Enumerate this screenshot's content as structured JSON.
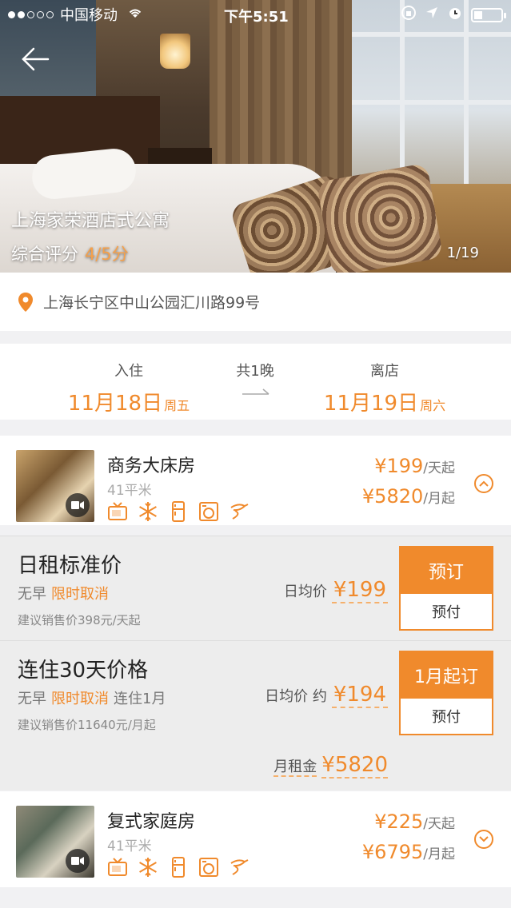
{
  "status_bar": {
    "carrier": "中国移动",
    "time": "下午5:51"
  },
  "hotel": {
    "name": "上海家荣酒店式公寓",
    "score_label": "综合评分",
    "score_value": "4/5分",
    "photo_counter": "1/19",
    "address": "上海长宁区中山公园汇川路99号"
  },
  "stay": {
    "checkin_label": "入住",
    "checkin_date": "11月18日",
    "checkin_weekday": "周五",
    "nights": "共1晚",
    "checkout_label": "离店",
    "checkout_date": "11月19日",
    "checkout_weekday": "周六"
  },
  "rooms": [
    {
      "name": "商务大床房",
      "area": "41平米",
      "daily_price": "¥199",
      "daily_suffix": "/天起",
      "monthly_price": "¥5820",
      "monthly_suffix": "/月起",
      "amenities": [
        "tv-icon",
        "ac-icon",
        "fridge-icon",
        "washer-icon",
        "hairdryer-icon"
      ],
      "expanded": true
    },
    {
      "name": "复式家庭房",
      "area": "41平米",
      "daily_price": "¥225",
      "daily_suffix": "/天起",
      "monthly_price": "¥6795",
      "monthly_suffix": "/月起",
      "amenities": [
        "tv-icon",
        "ac-icon",
        "fridge-icon",
        "washer-icon",
        "hairdryer-icon"
      ],
      "expanded": false
    }
  ],
  "plans": [
    {
      "title": "日租标准价",
      "breakfast": "无早",
      "cancel": "限时取消",
      "advice": "建议销售价398元/天起",
      "avg_label": "日均价",
      "avg_price": "¥199",
      "book_label": "预订",
      "pay_label": "预付"
    },
    {
      "title": "连住30天价格",
      "breakfast": "无早",
      "cancel": "限时取消",
      "stay_req": "连住1月",
      "advice": "建议销售价11640元/月起",
      "avg_label": "日均价 约",
      "avg_price": "¥194",
      "book_label": "1月起订",
      "pay_label": "预付",
      "monthly_label": "月租金",
      "monthly_price": "¥5820"
    }
  ],
  "colors": {
    "accent": "#f08a2c",
    "background": "#f1f1f3"
  }
}
